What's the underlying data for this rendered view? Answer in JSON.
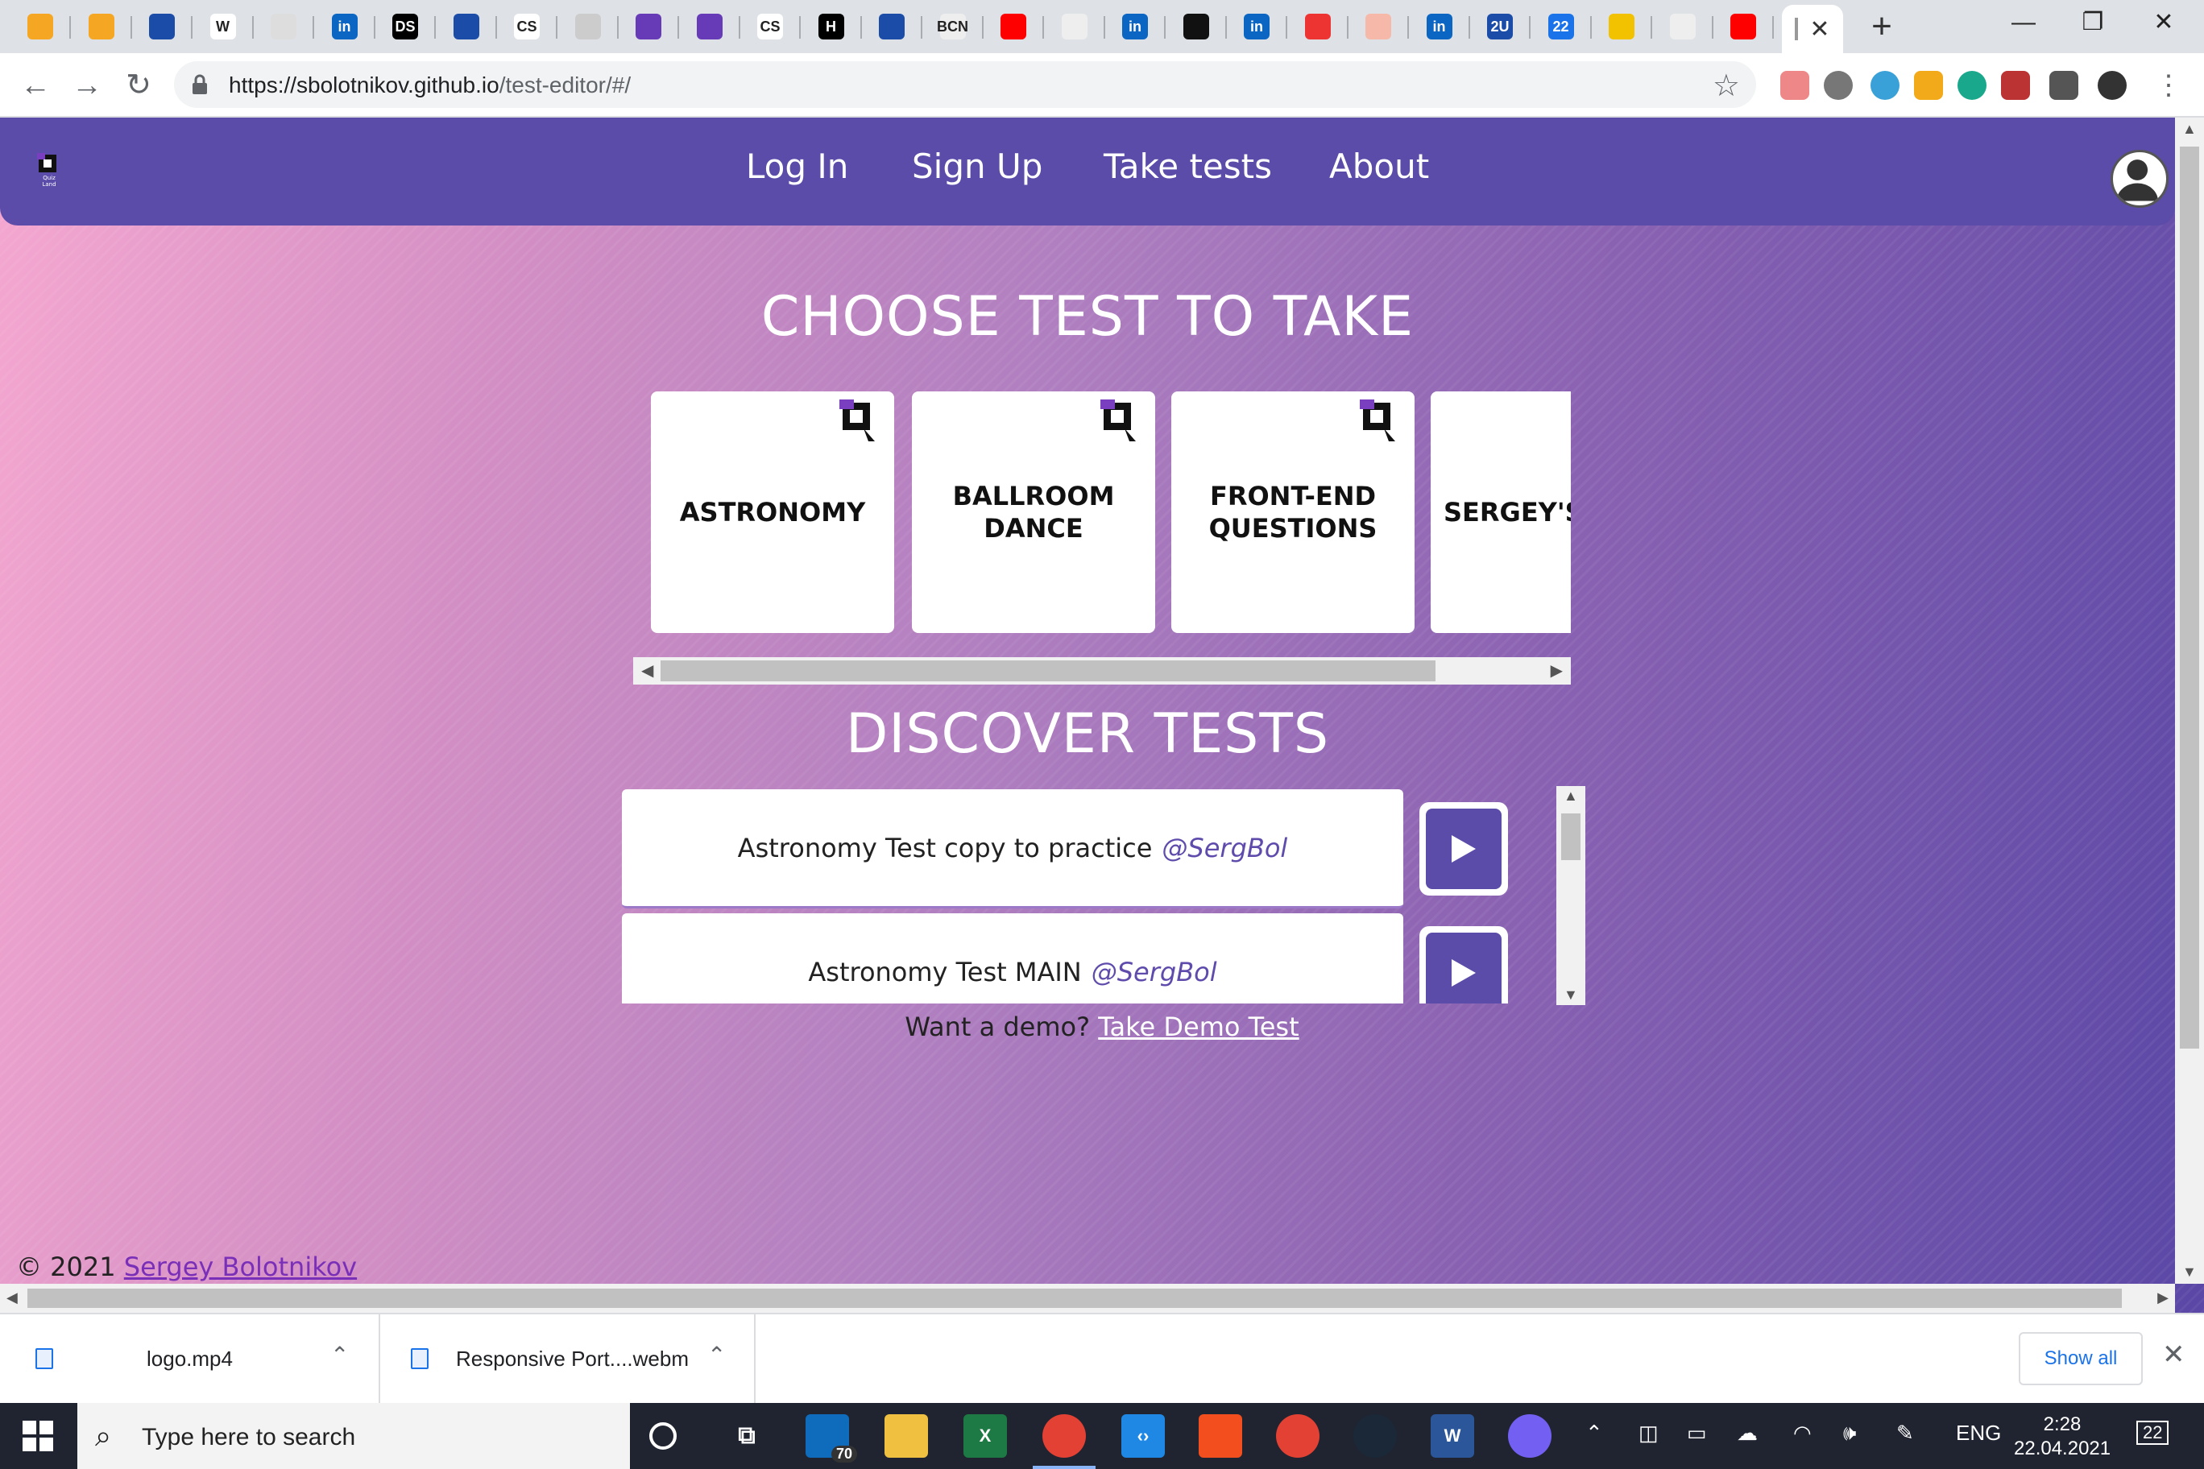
{
  "browser": {
    "url_host": "https://sbolotnikov.github.io",
    "url_path": "/test-editor/#/",
    "tab_icons": [
      "firebase-icon",
      "firebase-icon",
      "w3-icon",
      "wikipedia-icon",
      "doc-icon",
      "linkedin-icon",
      "ds-icon",
      "circle-icon",
      "cs-icon",
      "project-icon",
      "forms-icon",
      "forms-icon",
      "cs-icon",
      "hashnode-icon",
      "w3-icon",
      "bcn-icon",
      "youtube-icon",
      "owl-icon",
      "linkedin-icon",
      "github-icon",
      "linkedin-icon",
      "mu-icon",
      "figma-icon",
      "linkedin-icon",
      "2u-icon",
      "calendar-icon",
      "key-icon",
      "react-icon",
      "youtube-icon"
    ],
    "tab_labels": {
      "bcn": "BCN",
      "cs": "CS",
      "ds": "DS",
      "hashnode": "H",
      "wikipedia": "W",
      "2u": "2U",
      "calendar": "22",
      "linkedin": "in"
    },
    "new_tab_label": "+",
    "window_controls": [
      "—",
      "❐",
      "✕"
    ]
  },
  "site": {
    "nav": [
      "Log In",
      "Sign Up",
      "Take tests",
      "About"
    ],
    "logo_text": "Quiz Land",
    "choose_title": "CHOOSE TEST TO TAKE",
    "cards": [
      "ASTRONOMY",
      "BALLROOM DANCE",
      "FRONT-END QUESTIONS",
      "SERGEY'S"
    ],
    "discover_title": "DISCOVER TESTS",
    "discover": [
      {
        "title": "Astronomy Test copy to practice",
        "author": "@SergBol"
      },
      {
        "title": "Astronomy Test MAIN",
        "author": "@SergBol"
      }
    ],
    "demo_prefix": "Want a demo?",
    "demo_link": "Take Demo Test",
    "footer_prefix": "© 2021",
    "footer_link": "Sergey Bolotnikov"
  },
  "downloads": {
    "items": [
      "logo.mp4",
      "Responsive Port....webm"
    ],
    "show_all": "Show all"
  },
  "taskbar": {
    "search_placeholder": "Type here to search",
    "mail_badge": "70",
    "lang": "ENG",
    "time": "2:28",
    "date": "22.04.2021",
    "notifications": "22"
  },
  "colors": {
    "header": "#5a4ca8",
    "accent": "#5f4bab",
    "tabstrip": "#dee1e6"
  }
}
